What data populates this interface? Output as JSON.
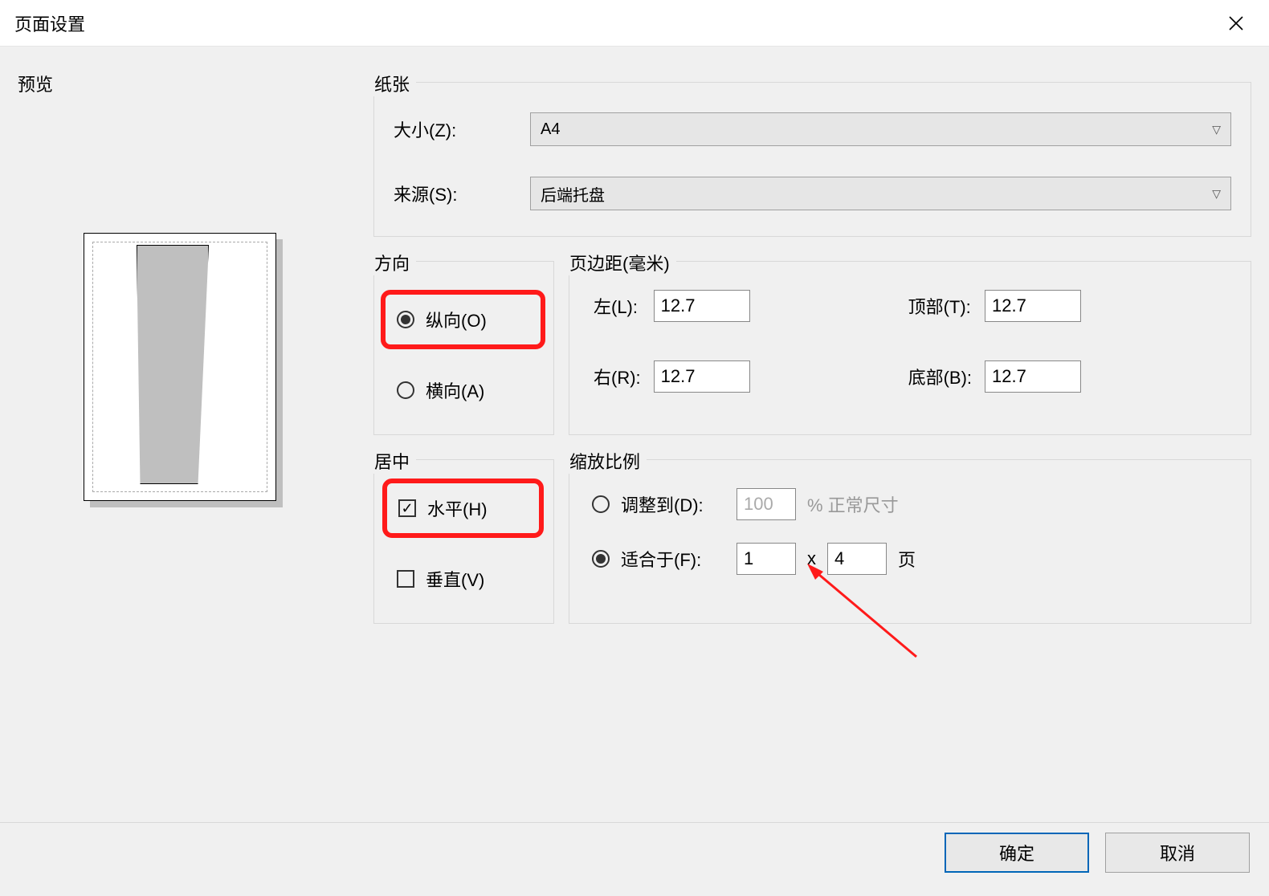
{
  "title": "页面设置",
  "preview_label": "预览",
  "paper": {
    "group": "纸张",
    "size_label": "大小(Z):",
    "size_value": "A4",
    "source_label": "来源(S):",
    "source_value": "后端托盘"
  },
  "orientation": {
    "group": "方向",
    "portrait": "纵向(O)",
    "landscape": "横向(A)",
    "selected": "portrait"
  },
  "margins": {
    "group": "页边距(毫米)",
    "left_label": "左(L):",
    "left": "12.7",
    "top_label": "顶部(T):",
    "top": "12.7",
    "right_label": "右(R):",
    "right": "12.7",
    "bottom_label": "底部(B):",
    "bottom": "12.7"
  },
  "center": {
    "group": "居中",
    "horizontal": "水平(H)",
    "vertical": "垂直(V)",
    "h_checked": true,
    "v_checked": false
  },
  "scale": {
    "group": "缩放比例",
    "adjust_label": "调整到(D):",
    "adjust_value": "100",
    "adjust_suffix": "% 正常尺寸",
    "fit_label": "适合于(F):",
    "fit_w": "1",
    "fit_x": "x",
    "fit_h": "4",
    "fit_suffix": "页",
    "selected": "fit"
  },
  "buttons": {
    "ok": "确定",
    "cancel": "取消"
  }
}
